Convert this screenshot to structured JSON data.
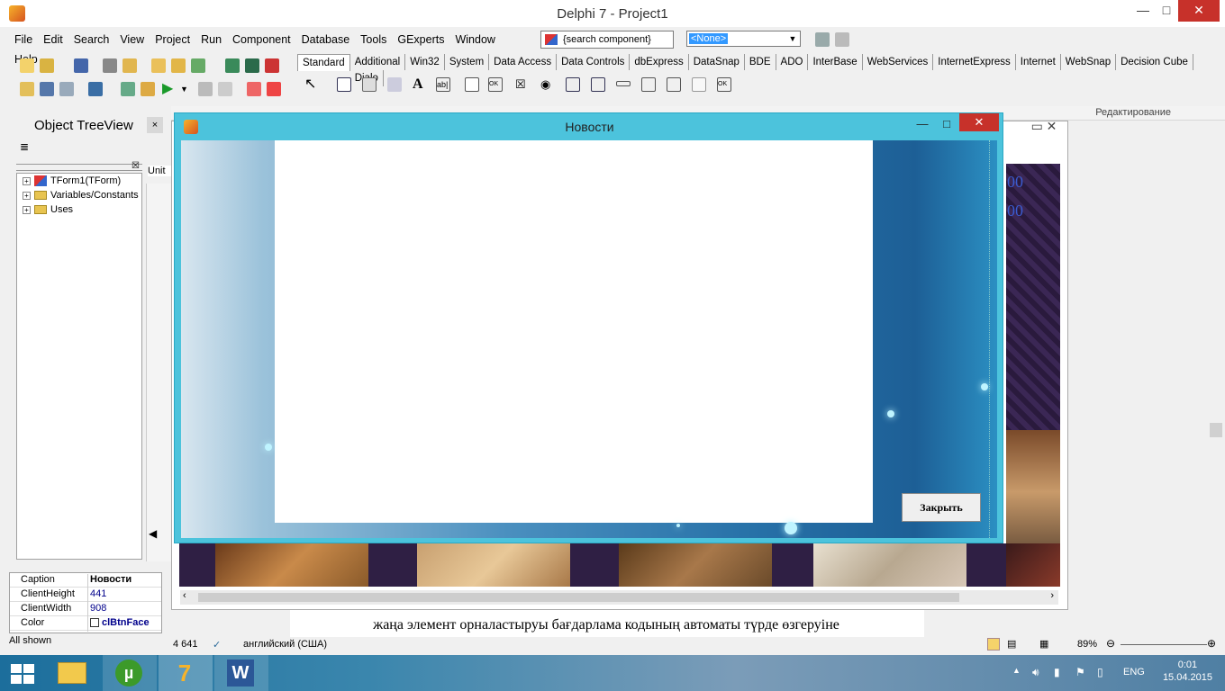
{
  "ide": {
    "title": "Delphi 7 - Project1",
    "menu": [
      "File",
      "Edit",
      "Search",
      "View",
      "Project",
      "Run",
      "Component",
      "Database",
      "Tools",
      "GExperts",
      "Window",
      "Help"
    ],
    "search_placeholder": "{search component}",
    "selector_value": "<None>",
    "palette_tabs": [
      "Standard",
      "Additional",
      "Win32",
      "System",
      "Data Access",
      "Data Controls",
      "dbExpress",
      "DataSnap",
      "BDE",
      "ADO",
      "InterBase",
      "WebServices",
      "InternetExpress",
      "Internet",
      "WebSnap",
      "Decision Cube",
      "Dialo"
    ],
    "ribbon_label": "Редактирование"
  },
  "treeview": {
    "title": "Object TreeView",
    "close": "×",
    "unit_tab": "Unit",
    "nodes": [
      "TForm1(TForm)",
      "Variables/Constants",
      "Uses"
    ]
  },
  "inspector": {
    "rows": [
      {
        "key": "Caption",
        "value": "Новости"
      },
      {
        "key": "ClientHeight",
        "value": "441"
      },
      {
        "key": "ClientWidth",
        "value": "908"
      },
      {
        "key": "Color",
        "value": "clBtnFace"
      }
    ],
    "footer": "All shown"
  },
  "dialog": {
    "title": "Новости",
    "close_button": "Закрыть"
  },
  "background": {
    "purple_text1": "00",
    "purple_text2": "00",
    "doc_line": "жаңа элемент орналастыруы бағдарлама кодының автоматы түрде өзгеруіне",
    "status_count": "4 641",
    "status_lang": "английский (США)",
    "zoom": "89%"
  },
  "taskbar": {
    "lang": "ENG",
    "time": "0:01",
    "date": "15.04.2015"
  },
  "colors": {
    "dialog_frame": "#4cc3dc",
    "close_red": "#c7312a",
    "taskbar": "#1c6e9c"
  }
}
